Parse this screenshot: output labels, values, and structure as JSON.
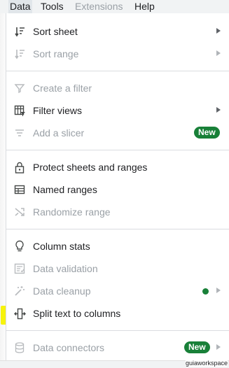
{
  "menubar": {
    "items": [
      {
        "label": "Data"
      },
      {
        "label": "Tools"
      },
      {
        "label": "Extensions"
      },
      {
        "label": "Help"
      }
    ]
  },
  "menu": {
    "items": [
      {
        "label": "Sort sheet",
        "icon": "sort-icon",
        "submenu": true,
        "disabled": false
      },
      {
        "label": "Sort range",
        "icon": "sort-icon",
        "submenu": true,
        "disabled": true
      },
      {
        "label": "Create a filter",
        "icon": "filter-icon",
        "disabled": true
      },
      {
        "label": "Filter views",
        "icon": "filter-views-icon",
        "submenu": true,
        "disabled": false
      },
      {
        "label": "Add a slicer",
        "icon": "slicer-icon",
        "disabled": true,
        "badge": "New"
      },
      {
        "label": "Protect sheets and ranges",
        "icon": "lock-icon",
        "disabled": false
      },
      {
        "label": "Named ranges",
        "icon": "named-ranges-icon",
        "disabled": false
      },
      {
        "label": "Randomize range",
        "icon": "shuffle-icon",
        "disabled": true
      },
      {
        "label": "Column stats",
        "icon": "lightbulb-icon",
        "disabled": false
      },
      {
        "label": "Data validation",
        "icon": "data-validation-icon",
        "disabled": true
      },
      {
        "label": "Data cleanup",
        "icon": "magic-wand-icon",
        "submenu": true,
        "disabled": true,
        "status_dot": true
      },
      {
        "label": "Split text to columns",
        "icon": "split-columns-icon",
        "disabled": false,
        "highlighted": true
      },
      {
        "label": "Data connectors",
        "icon": "database-icon",
        "submenu": true,
        "disabled": true,
        "badge": "New"
      }
    ]
  },
  "colors": {
    "badge_green": "#188038",
    "highlight_yellow": "#f7f30c",
    "disabled_text": "#9aa0a6"
  },
  "watermark": "guiaworkspace"
}
